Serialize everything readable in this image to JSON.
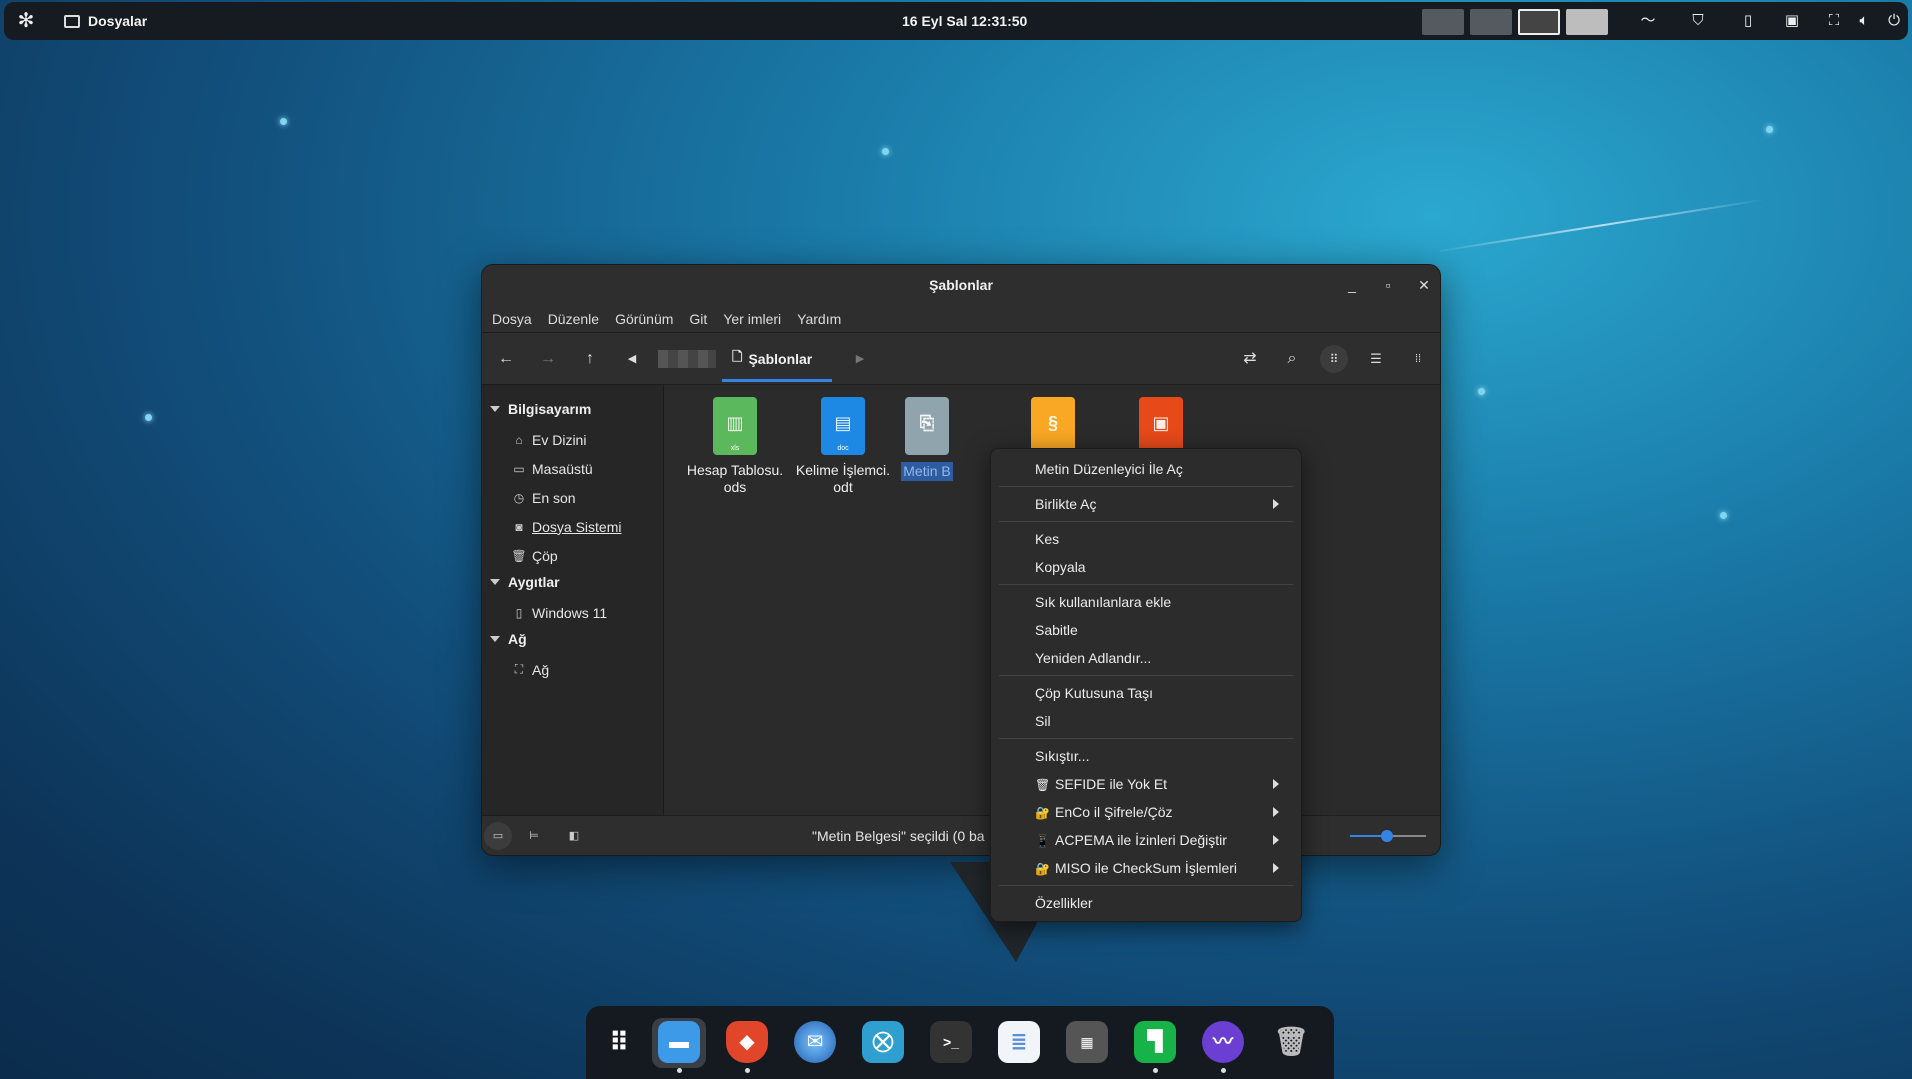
{
  "topbar": {
    "app_name": "Dosyalar",
    "clock": "16 Eyl Sal  12:31:50"
  },
  "window": {
    "title": "Şablonlar",
    "menu": [
      "Dosya",
      "Düzenle",
      "Görünüm",
      "Git",
      "Yer imleri",
      "Yardım"
    ],
    "breadcrumb": "Şablonlar",
    "sidebar": {
      "sections": [
        {
          "title": "Bilgisayarım",
          "items": [
            "Ev Dizini",
            "Masaüstü",
            "En son",
            "Dosya Sistemi",
            "Çöp"
          ]
        },
        {
          "title": "Aygıtlar",
          "items": [
            "Windows 11"
          ]
        },
        {
          "title": "Ağ",
          "items": [
            "Ağ"
          ]
        }
      ]
    },
    "files": [
      {
        "name": "Hesap Tablosu.\nods",
        "color": "#4caf50",
        "tag": "xls"
      },
      {
        "name": "Kelime İşlemci.\nodt",
        "color": "#1e88e5",
        "tag": "doc"
      },
      {
        "name": "Metin B",
        "color": "#90a4ae",
        "tag": ""
      },
      {
        "name": "",
        "color": "#f9a825",
        "tag": ""
      },
      {
        "name": "",
        "color": "#e64a19",
        "tag": ""
      }
    ],
    "status": "\"Metin Belgesi\" seçildi (0 ba"
  },
  "context_menu": {
    "items": [
      {
        "label": "Metin Düzenleyici İle Aç"
      },
      {
        "sep": true
      },
      {
        "label": "Birlikte Aç",
        "sub": true
      },
      {
        "sep": true
      },
      {
        "label": "Kes"
      },
      {
        "label": "Kopyala"
      },
      {
        "sep": true
      },
      {
        "label": "Sık kullanılanlara ekle"
      },
      {
        "label": "Sabitle"
      },
      {
        "label": "Yeniden Adlandır..."
      },
      {
        "sep": true
      },
      {
        "label": "Çöp Kutusuna Taşı"
      },
      {
        "label": "Sil"
      },
      {
        "sep": true
      },
      {
        "label": "Sıkıştır..."
      },
      {
        "label": "SEFIDE ile Yok Et",
        "sub": true,
        "emoji": "🗑"
      },
      {
        "label": "EnCo il Şifrele/Çöz",
        "sub": true,
        "emoji": "🔐"
      },
      {
        "label": "ACPEMA ile İzinleri Değiştir",
        "sub": true,
        "emoji": "📱"
      },
      {
        "label": "MISO ile CheckSum İşlemleri",
        "sub": true,
        "emoji": "🔐"
      },
      {
        "sep": true
      },
      {
        "label": "Özellikler"
      }
    ]
  }
}
